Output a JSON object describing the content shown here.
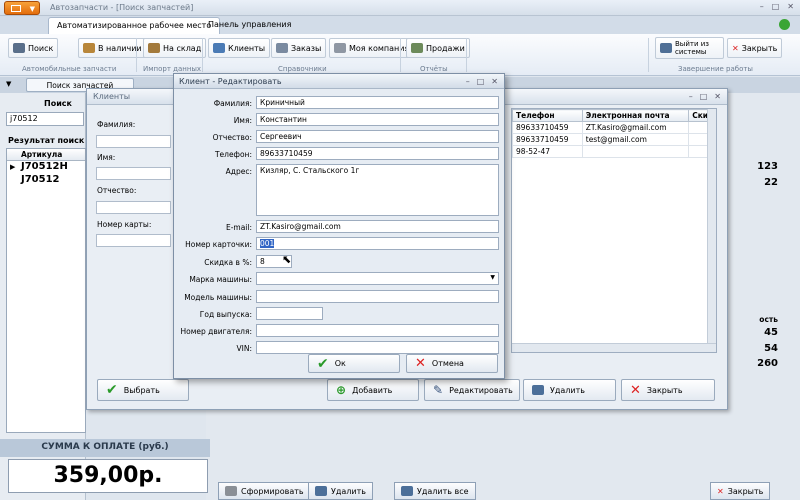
{
  "window": {
    "title": "Автозапчасти - [Поиск запчастей]"
  },
  "ribbon": {
    "tabs": [
      "Автоматизированное рабочее место",
      "Панель управления"
    ],
    "buttons": {
      "search": "Поиск",
      "in_stock": "В наличии",
      "to_stock": "На склад",
      "clients": "Клиенты",
      "orders": "Заказы",
      "my_company": "Моя компания",
      "sales": "Продажи",
      "logout": "Выйти из системы",
      "close": "Закрыть"
    },
    "groups": [
      "Автомобильные запчасти",
      "Импорт данных",
      "Справочники",
      "Отчёты",
      "Завершение работы"
    ]
  },
  "search_strip": {
    "tab": "Поиск запчастей"
  },
  "left_panel": {
    "search_label": "Поиск",
    "search_value": "j70512",
    "result_label": "Результат поиск",
    "column": "Артикула",
    "rows": [
      "J70512H",
      "J70512"
    ],
    "sum_label": "СУММА К ОПЛАТЕ (руб.)",
    "sum_value": "359,00р."
  },
  "right_numbers": {
    "top": [
      "123",
      "22"
    ],
    "qty_header": "ость",
    "bottom": [
      "45",
      "54",
      "260"
    ]
  },
  "bottom_bar": {
    "form": "Сформировать",
    "delete": "Удалить",
    "delete_all": "Удалить все",
    "close": "Закрыть"
  },
  "clients_window": {
    "title": "Клиенты",
    "labels": {
      "last_name": "Фамилия:",
      "first_name": "Имя:",
      "patronymic": "Отчество:",
      "card": "Номер карты:"
    },
    "grid": {
      "columns": [
        "Телефон",
        "Электронная почта",
        "Ски"
      ],
      "rows": [
        [
          "89633710459",
          "ZT.Kasiro@gmail.com",
          ""
        ],
        [
          "89633710459",
          "test@gmail.com",
          ""
        ],
        [
          "98-52-47",
          "",
          ""
        ]
      ]
    },
    "buttons": {
      "select": "Выбрать",
      "add": "Добавить",
      "edit": "Редактировать",
      "delete": "Удалить",
      "close": "Закрыть"
    }
  },
  "edit_dialog": {
    "title": "Клиент - Редактировать",
    "fields": [
      {
        "label": "Фамилия:",
        "value": "Криничный"
      },
      {
        "label": "Имя:",
        "value": "Константин"
      },
      {
        "label": "Отчество:",
        "value": "Сергеевич"
      },
      {
        "label": "Телефон:",
        "value": "89633710459"
      },
      {
        "label": "Адрес:",
        "value": "Кизляр, С. Стальского 1г"
      },
      {
        "label": "E-mail:",
        "value": "ZT.Kasiro@gmail.com"
      },
      {
        "label": "Номер карточки:",
        "value": "001"
      },
      {
        "label": "Скидка в %:",
        "value": "8"
      },
      {
        "label": "Марка машины:",
        "value": ""
      },
      {
        "label": "Модель машины:",
        "value": ""
      },
      {
        "label": "Год выпуска:",
        "value": ""
      },
      {
        "label": "Номер двигателя:",
        "value": ""
      },
      {
        "label": "VIN:",
        "value": ""
      }
    ],
    "ok": "Ок",
    "cancel": "Отмена"
  }
}
